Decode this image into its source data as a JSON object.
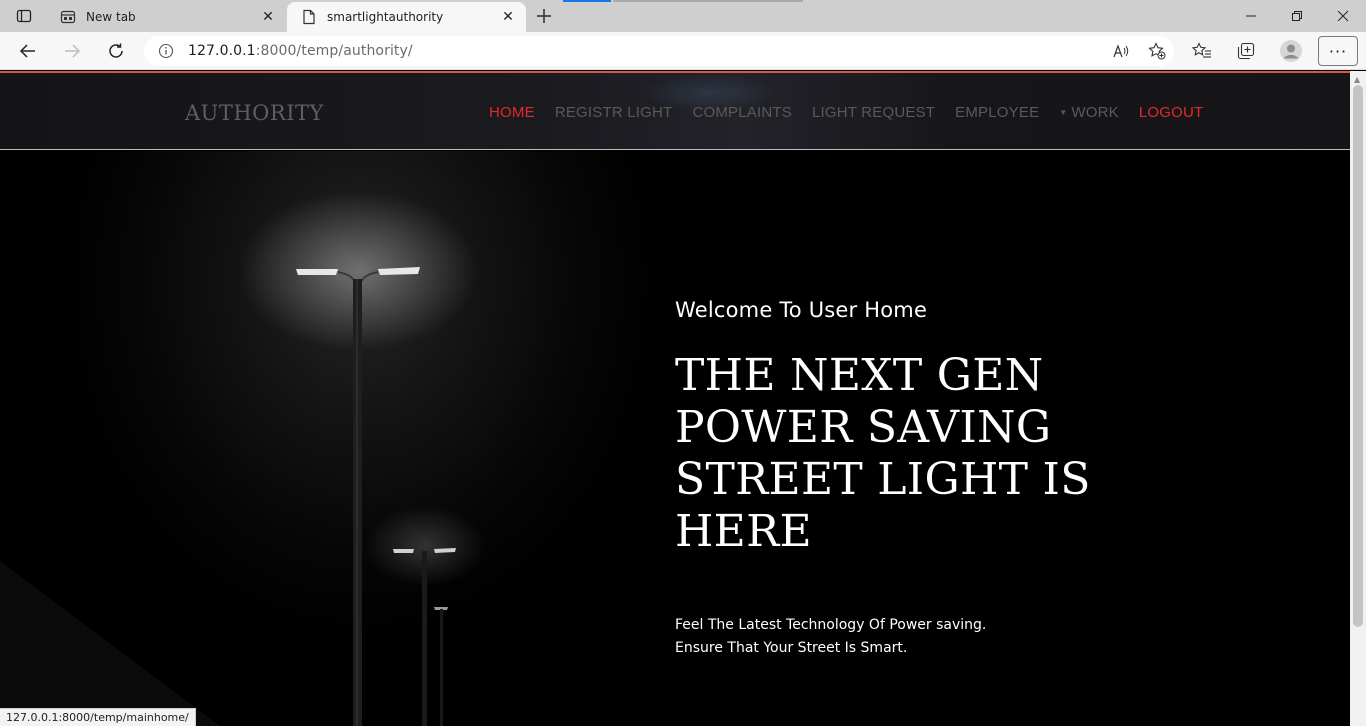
{
  "browser": {
    "tabs": [
      {
        "title": "New tab",
        "icon": "new-tab-page-icon",
        "active": false
      },
      {
        "title": "smartlightauthority",
        "icon": "document-icon",
        "active": true
      }
    ],
    "url_host": "127.0.0.1",
    "url_rest": ":8000/temp/authority/",
    "status_url": "127.0.0.1:8000/temp/mainhome/"
  },
  "site": {
    "brand": "AUTHORITY",
    "nav": [
      {
        "label": "HOME",
        "color": "#e5292b"
      },
      {
        "label": "REGISTR LIGHT",
        "color": "#5a5a5a"
      },
      {
        "label": "COMPLAINTS",
        "color": "#5a5a5a"
      },
      {
        "label": "LIGHT REQUEST",
        "color": "#5a5a5a"
      },
      {
        "label": "EMPLOYEE",
        "color": "#5a5a5a"
      },
      {
        "label": "WORK",
        "color": "#5a5a5a",
        "dropdown": true
      },
      {
        "label": "LOGOUT",
        "color": "#e5292b"
      }
    ]
  },
  "hero": {
    "welcome": "Welcome To User Home",
    "headline": "THE NEXT GEN POWER SAVING STREET LIGHT IS HERE",
    "tagline_1": "Feel The Latest Technology Of Power saving.",
    "tagline_2": "Ensure That Your Street Is Smart."
  }
}
